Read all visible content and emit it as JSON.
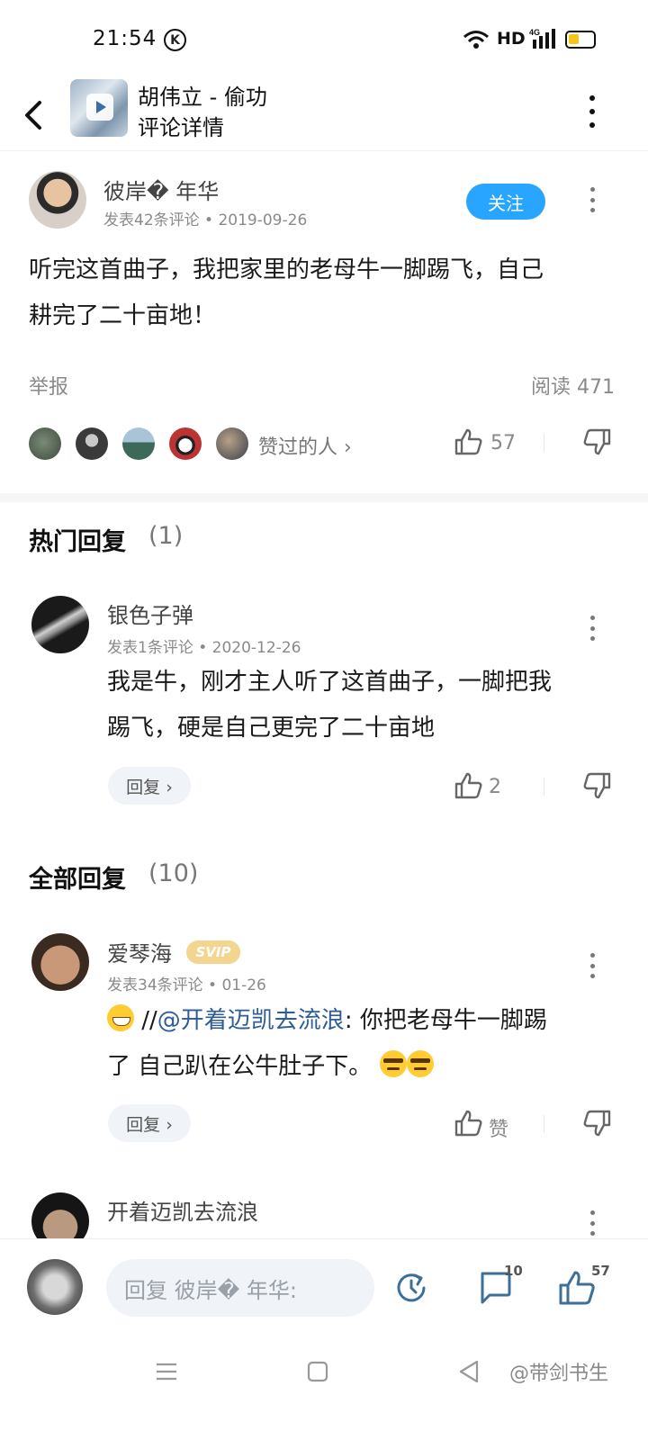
{
  "status_bar": {
    "time": "21:54",
    "k_label": "K",
    "network": "HD",
    "network_type": "4G"
  },
  "header": {
    "song_title": "胡伟立 - 偷功",
    "page_title": "评论详情"
  },
  "main_comment": {
    "username": "彼岸� 年华",
    "meta": "发表42条评论 • 2019-09-26",
    "follow_label": "关注",
    "text_line1": "听完这首曲子，我把家里的老母牛一脚踢飞，自己",
    "text_line2": "耕完了二十亩地！",
    "report_label": "举报",
    "read_count": "阅读 471",
    "likers_label": "赞过的人 ›",
    "like_count": "57"
  },
  "hot_section": {
    "title": "热门回复",
    "count": "(1)"
  },
  "hot_reply": {
    "username": "银色子弹",
    "meta": "发表1条评论 • 2020-12-26",
    "text_line1": "我是牛，刚才主人听了这首曲子，一脚把我",
    "text_line2": "踢飞，硬是自己更完了二十亩地",
    "reply_label": "回复 ›",
    "like_count": "2"
  },
  "all_section": {
    "title": "全部回复",
    "count": "(10)"
  },
  "reply1": {
    "username": "爱琴海",
    "badge": "SVIP",
    "meta": "发表34条评论 • 01-26",
    "prefix": "//",
    "mention": "@开着迈凯去流浪",
    "text_line1_rest": ": 你把老母牛一脚踢",
    "text_line2": "了  自己趴在公牛肚子下。",
    "reply_label": "回复 ›",
    "like_label": "赞"
  },
  "reply2": {
    "username": "开着迈凯去流浪"
  },
  "bottom_bar": {
    "input_placeholder": "回复 彼岸� 年华:",
    "comment_count": "10",
    "like_count": "57"
  },
  "watermark": "@带剑书生",
  "colors": {
    "accent": "#27a5ff",
    "mention": "#2d5c97",
    "svip": "#f4d58f"
  }
}
